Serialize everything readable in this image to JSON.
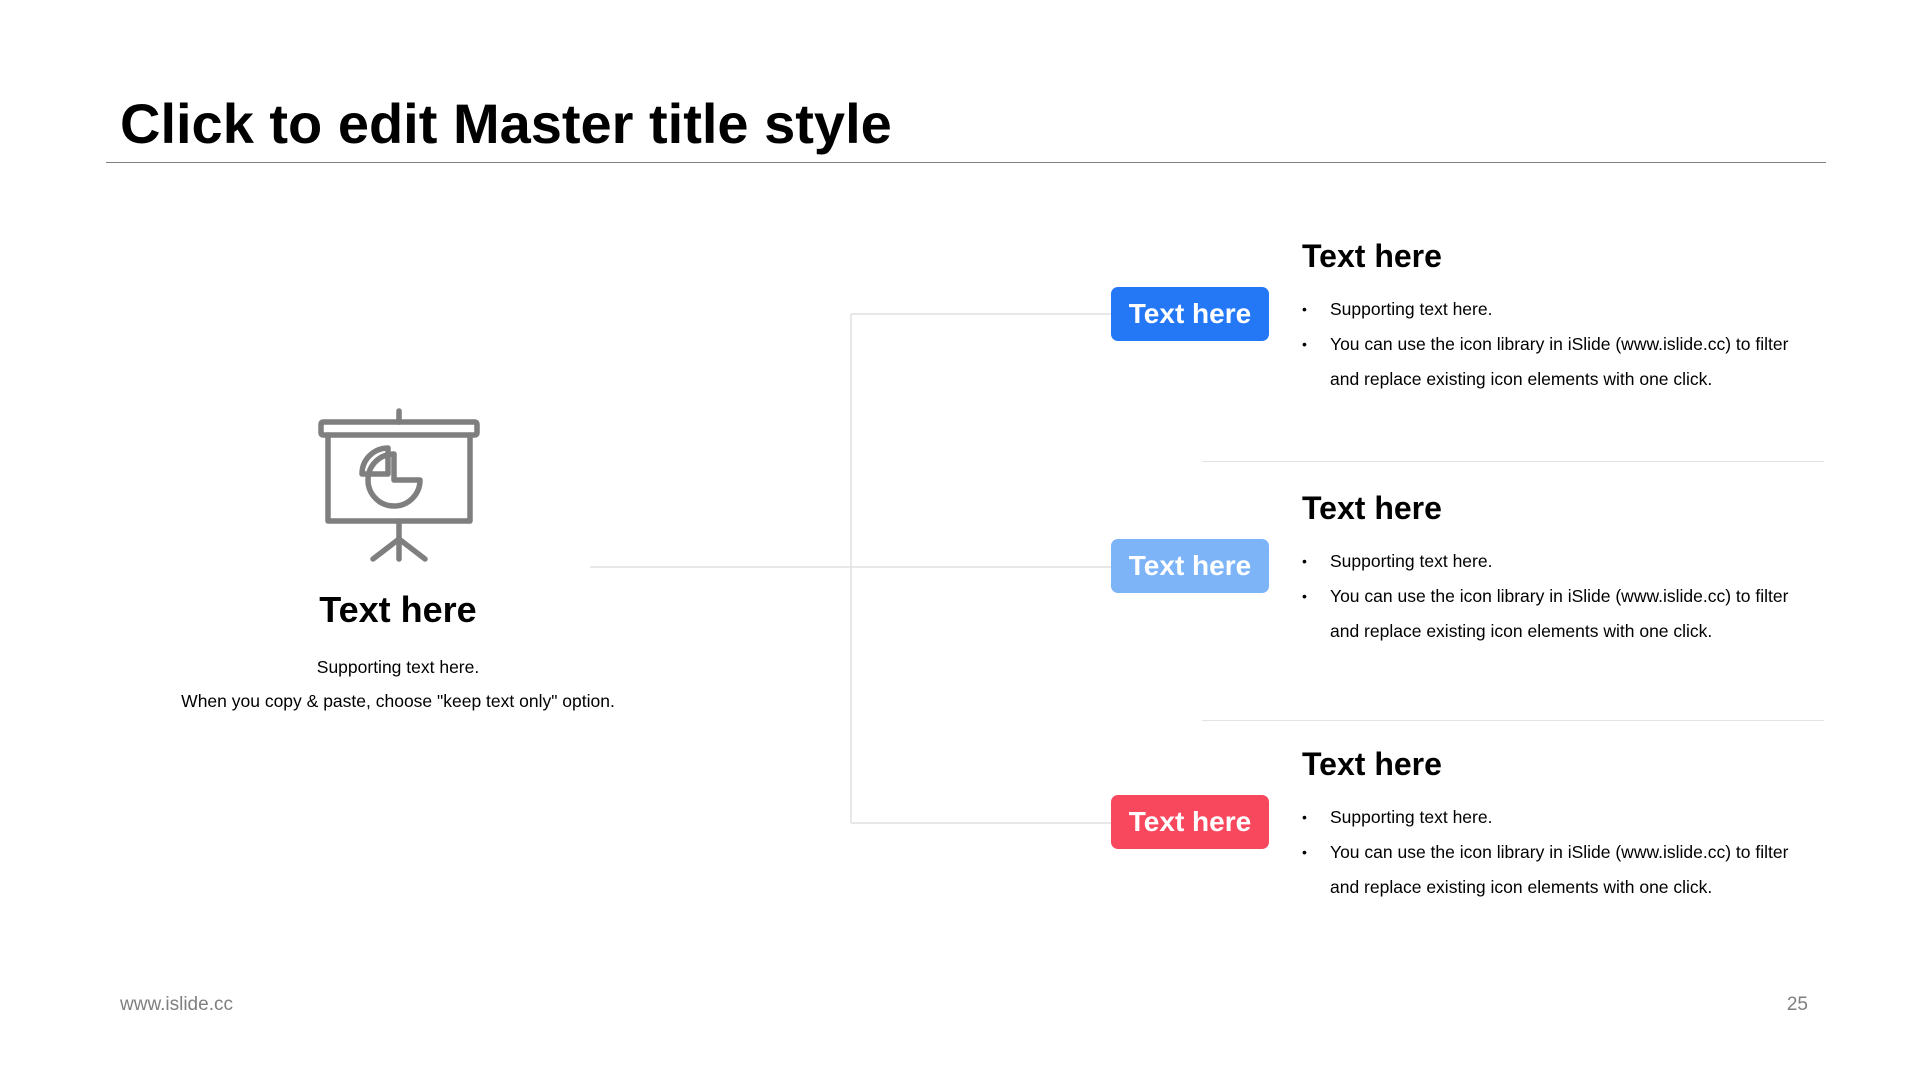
{
  "title": "Click to edit Master title style",
  "left": {
    "icon": "presentation-screen-pie-chart-icon",
    "heading": "Text here",
    "support_lines": [
      "Supporting text here.",
      "When you copy & paste, choose \"keep text only\" option."
    ]
  },
  "items": [
    {
      "tag": "Text here",
      "tag_color": "#2478f6",
      "heading": "Text here",
      "bullets": [
        "Supporting text here.",
        "You can use the icon library in iSlide  (www.islide.cc) to filter and replace existing icon elements with one click."
      ]
    },
    {
      "tag": "Text here",
      "tag_color": "#7db4f8",
      "heading": "Text here",
      "bullets": [
        "Supporting text here.",
        "You can use the icon library in iSlide  (www.islide.cc) to filter and replace existing icon elements with one click."
      ]
    },
    {
      "tag": "Text here",
      "tag_color": "#f8485e",
      "heading": "Text here",
      "bullets": [
        "Supporting text here.",
        "You can use the icon library in iSlide  (www.islide.cc) to filter and replace existing icon elements with one click."
      ]
    }
  ],
  "footer": {
    "url": "www.islide.cc",
    "page_number": "25"
  }
}
